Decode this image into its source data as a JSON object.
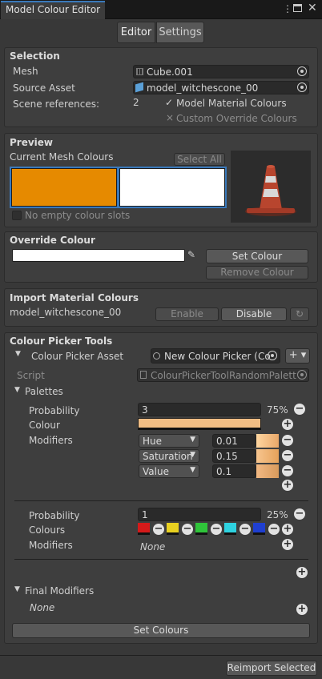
{
  "window": {
    "title": "Model Colour Editor"
  },
  "tabs": [
    "Editor",
    "Settings"
  ],
  "selection": {
    "header": "Selection",
    "mesh_label": "Mesh",
    "mesh_value": "Cube.001",
    "source_label": "Source Asset",
    "source_value": "model_witchescone_00",
    "scene_label": "Scene references:",
    "scene_count": "2",
    "toggle1": "Model Material Colours",
    "toggle2": "Custom Override Colours"
  },
  "preview": {
    "header": "Preview",
    "mesh_colours_label": "Current Mesh Colours",
    "select_all": "Select All",
    "no_empty": "No empty colour slots",
    "colours": [
      "#e68a00",
      "#ffffff"
    ]
  },
  "override": {
    "header": "Override Colour",
    "set_colour": "Set Colour",
    "remove_colour": "Remove Colour",
    "current": "#ffffff"
  },
  "import": {
    "header": "Import Material Colours",
    "asset": "model_witchescone_00",
    "enable": "Enable",
    "disable": "Disable"
  },
  "picker": {
    "header": "Colour Picker Tools",
    "asset_label": "Colour Picker Asset",
    "asset_value": "New Colour Picker (Co",
    "script_label": "Script",
    "script_value": "ColourPickerToolRandomPalett",
    "palettes_label": "Palettes",
    "palette1": {
      "probability_label": "Probability",
      "probability": "3",
      "percent": "75%",
      "colour_label": "Colour",
      "colour": "#f0bd84",
      "modifiers_label": "Modifiers",
      "modifiers": [
        {
          "type": "Hue",
          "value": "0.01"
        },
        {
          "type": "Saturation",
          "value": "0.15"
        },
        {
          "type": "Value",
          "value": "0.1"
        }
      ]
    },
    "palette2": {
      "probability_label": "Probability",
      "probability": "1",
      "percent": "25%",
      "colours_label": "Colours",
      "colours": [
        "#d41a1a",
        "#e8d020",
        "#2fc43a",
        "#2ed2e0",
        "#1f3fd0"
      ],
      "modifiers_label": "Modifiers",
      "modifiers_value": "None"
    },
    "final_label": "Final Modifiers",
    "final_value": "None",
    "set_colours": "Set Colours"
  },
  "footer": {
    "reimport": "Reimport Selected"
  }
}
